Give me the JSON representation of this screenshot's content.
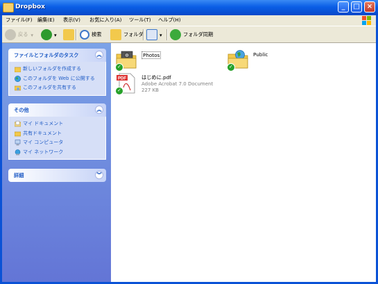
{
  "window": {
    "title": "Dropbox",
    "minimize_glyph": "_",
    "maximize_glyph": "□",
    "close_glyph": "×"
  },
  "menubar": {
    "items": [
      "ファイル(F)",
      "編集(E)",
      "表示(V)",
      "お気に入り(A)",
      "ツール(T)",
      "ヘルプ(H)"
    ]
  },
  "toolbar": {
    "back_label": "戻る",
    "search_label": "検索",
    "folders_label": "フォルダ",
    "sync_label": "フォルダ同期"
  },
  "leftpane": {
    "tasks": {
      "title": "ファイルとフォルダのタスク",
      "items": [
        "新しいフォルダを作成する",
        "このフォルダを Web に公開する",
        "このフォルダを共有する"
      ]
    },
    "other": {
      "title": "その他",
      "items": [
        "マイ ドキュメント",
        "共有ドキュメント",
        "マイ コンピュータ",
        "マイ ネットワーク"
      ]
    },
    "details": {
      "title": "詳細"
    }
  },
  "files": [
    {
      "name": "Photos",
      "icon": "photo-folder-icon",
      "synced": true
    },
    {
      "name": "Public",
      "icon": "globe-folder-icon",
      "synced": true
    },
    {
      "name": "はじめに.pdf",
      "type": "Adobe Acrobat 7.0 Document",
      "size": "227 KB",
      "icon": "pdf-icon",
      "synced": true
    }
  ],
  "colors": {
    "titlebar": "#0a5ee6",
    "leftpane_top": "#7ba2e7",
    "leftpane_bottom": "#6375d6",
    "panel_link": "#215dc6",
    "sync_check": "#27a12a"
  }
}
